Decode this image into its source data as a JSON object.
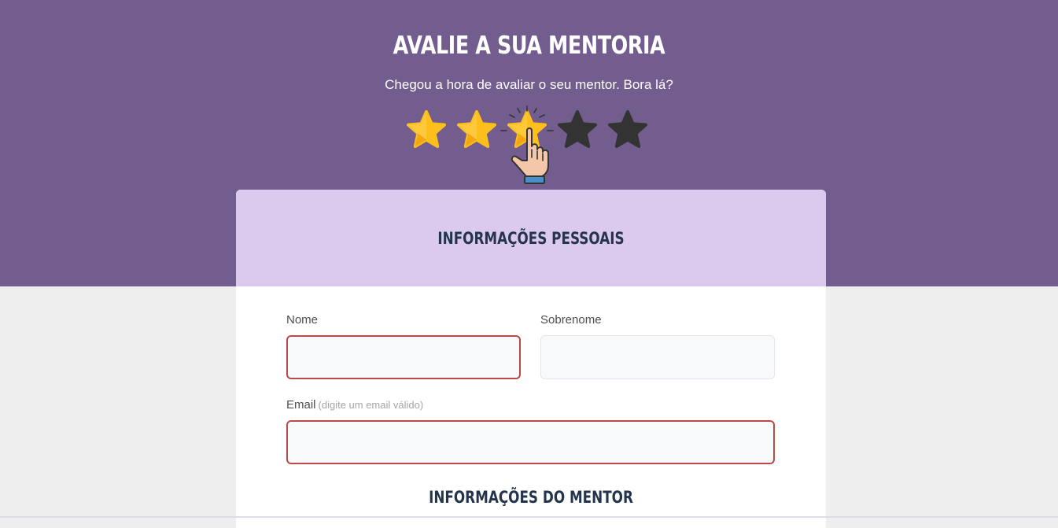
{
  "hero": {
    "title": "AVALIE A SUA MENTORIA",
    "subtitle": "Chegou a hora de avaliar o seu mentor. Bora lá?",
    "rating": {
      "value": 3,
      "max": 5
    },
    "colors": {
      "background": "#735d8e",
      "star_filled": "#fdbf1b",
      "star_empty": "#333333"
    }
  },
  "form": {
    "personal_section_title": "INFORMAÇÕES PESSOAIS",
    "first_name": {
      "label": "Nome",
      "value": "",
      "placeholder": ""
    },
    "last_name": {
      "label": "Sobrenome",
      "value": "",
      "placeholder": ""
    },
    "email": {
      "label": "Email",
      "hint": "(digite um email válido)",
      "value": "",
      "placeholder": ""
    },
    "mentor_section_title": "INFORMAÇÕES DO MENTOR",
    "colors": {
      "header": "#dbcaee",
      "error_border": "#b84a4a",
      "title_text": "#24344d"
    }
  }
}
